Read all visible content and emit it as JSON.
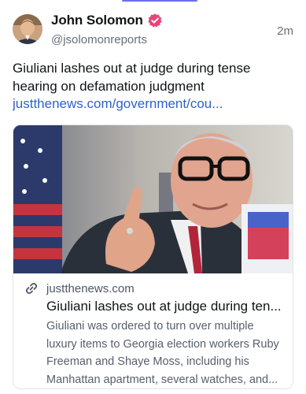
{
  "post": {
    "author": {
      "display_name": "John Solomon",
      "handle": "@jsolomonreports",
      "verified": true,
      "verified_color": "#e4457a"
    },
    "timestamp": "2m",
    "text": "Giuliani lashes out at judge during tense hearing on defamation judgment",
    "link_text": "justthenews.com/government/cou..."
  },
  "card": {
    "domain": "justthenews.com",
    "title": "Giuliani lashes out at judge during ten...",
    "description": "Giuliani was ordered to turn over multiple luxury items to Georgia election workers Ruby Freeman and Shaye Moss, including his Manhattan apartment, several watches, and..."
  },
  "colors": {
    "link": "#2f5fd6",
    "accent": "#6a6ef0",
    "muted_text": "#66707c"
  },
  "icons": {
    "verified": "verified-check-icon",
    "link": "link-icon"
  }
}
